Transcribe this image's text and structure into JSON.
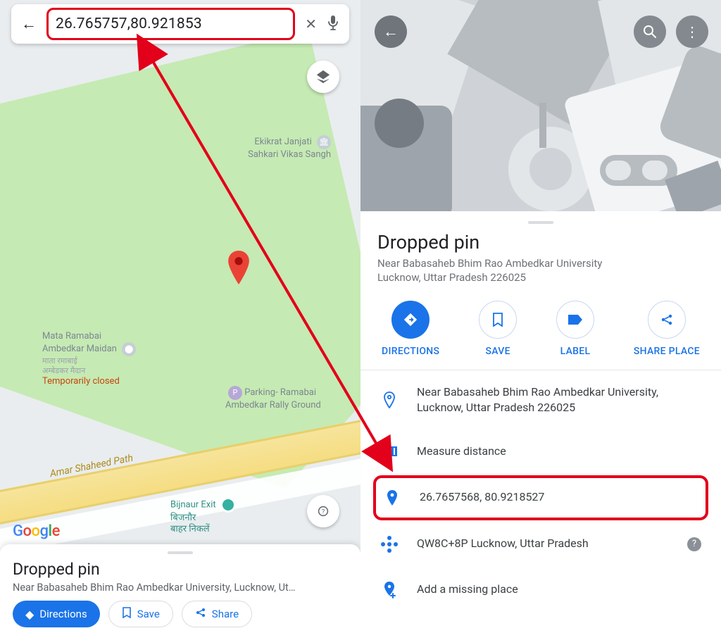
{
  "left": {
    "search_value": "26.765757,80.921853",
    "road_label": "Amar Shaheed Path",
    "poi1": {
      "title": "Ekikrat Janjati",
      "line2": "Sahkari Vikas Sangh"
    },
    "poi2": {
      "title": "Mata Ramabai",
      "line2": "Ambedkar Maidan",
      "hi1": "माता रमाबाई",
      "hi2": "अम्बेडकर मैदान",
      "closed": "Temporarily closed"
    },
    "poi3": {
      "title": "Parking- Ramabai",
      "line2": "Ambedkar Rally Ground"
    },
    "bijnaur": {
      "en": "Bijnaur Exit",
      "hi1": "बिजनौर",
      "hi2": "बाहर निकलें"
    },
    "sheet": {
      "title": "Dropped pin",
      "address": "Near Babasaheb Bhim Rao Ambedkar University, Lucknow, Ut…",
      "directions": "Directions",
      "save": "Save",
      "share": "Share"
    }
  },
  "right": {
    "title": "Dropped pin",
    "address_line1": "Near Babasaheb Bhim Rao Ambedkar University",
    "address_line2": "Lucknow, Uttar Pradesh 226025",
    "actions": {
      "directions": "DIRECTIONS",
      "save": "SAVE",
      "label": "LABEL",
      "share": "SHARE PLACE"
    },
    "rows": {
      "address": "Near Babasaheb Bhim Rao Ambedkar University, Lucknow, Uttar Pradesh 226025",
      "measure": "Measure distance",
      "coords": "26.7657568, 80.9218527",
      "pluscode": "QW8C+8P Lucknow, Uttar Pradesh",
      "addplace": "Add a missing place"
    }
  }
}
